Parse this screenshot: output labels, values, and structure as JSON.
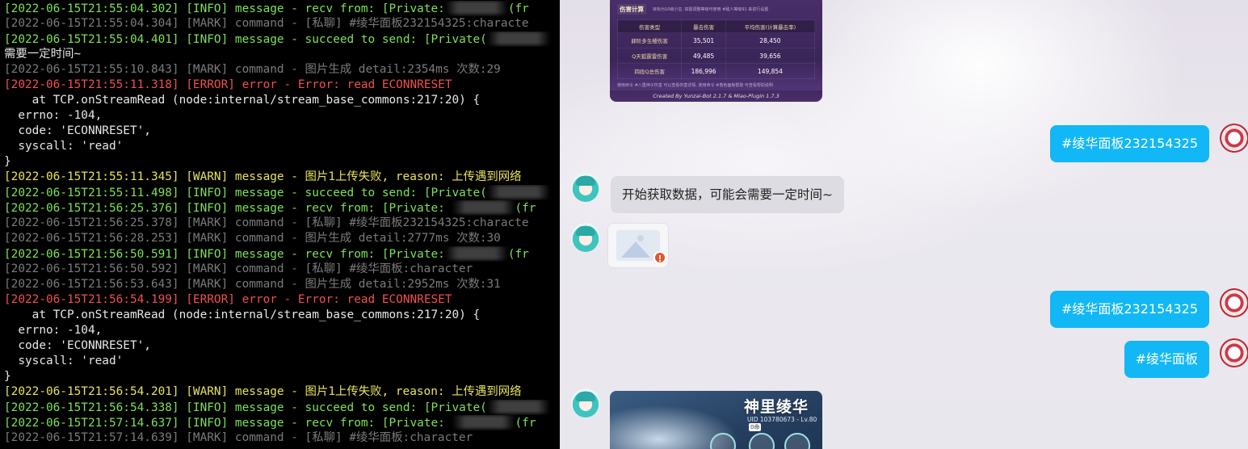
{
  "terminal": {
    "lines": [
      {
        "c": "c-info",
        "t": "[2022-06-15T21:55:04.302] [INFO] message - recv from: [Private:",
        "r": true,
        "s": "(fr"
      },
      {
        "c": "c-mark",
        "t": "[2022-06-15T21:55:04.304] [MARK] command - [私聊] #绫华面板232154325:characte",
        "r": false,
        "s": ""
      },
      {
        "c": "c-info",
        "t": "[2022-06-15T21:55:04.401] [INFO] message - succeed to send: [Private(",
        "r": true,
        "s": ""
      },
      {
        "c": "c-plain",
        "t": "需要一定时间~",
        "r": false,
        "s": ""
      },
      {
        "c": "c-mark",
        "t": "[2022-06-15T21:55:10.843] [MARK] command - 图片生成 detail:2354ms 次数:29",
        "r": false,
        "s": ""
      },
      {
        "c": "c-err",
        "t": "[2022-06-15T21:55:11.318] [ERROR] error - Error: read ECONNRESET",
        "r": false,
        "s": ""
      },
      {
        "c": "c-plain",
        "t": "    at TCP.onStreamRead (node:internal/stream_base_commons:217:20) {",
        "r": false,
        "s": ""
      },
      {
        "c": "c-plain",
        "t": "  errno: -104,",
        "r": false,
        "s": ""
      },
      {
        "c": "c-plain",
        "t": "  code: 'ECONNRESET',",
        "r": false,
        "s": ""
      },
      {
        "c": "c-plain",
        "t": "  syscall: 'read'",
        "r": false,
        "s": ""
      },
      {
        "c": "c-plain",
        "t": "}",
        "r": false,
        "s": ""
      },
      {
        "c": "c-warn",
        "t": "[2022-06-15T21:55:11.345] [WARN] message - 图片1上传失败, reason: 上传遇到网络",
        "r": false,
        "s": ""
      },
      {
        "c": "c-info",
        "t": "[2022-06-15T21:55:11.498] [INFO] message - succeed to send: [Private(",
        "r": true,
        "s": ""
      },
      {
        "c": "c-info",
        "t": "[2022-06-15T21:56:25.376] [INFO] message - recv from: [Private: ",
        "r": true,
        "s": "(fr"
      },
      {
        "c": "c-mark",
        "t": "[2022-06-15T21:56:25.378] [MARK] command - [私聊] #绫华面板232154325:characte",
        "r": false,
        "s": ""
      },
      {
        "c": "c-mark",
        "t": "[2022-06-15T21:56:28.253] [MARK] command - 图片生成 detail:2777ms 次数:30",
        "r": false,
        "s": ""
      },
      {
        "c": "c-info",
        "t": "[2022-06-15T21:56:50.591] [INFO] message - recv from: [Private:",
        "r": true,
        "s": "(fr"
      },
      {
        "c": "c-mark",
        "t": "[2022-06-15T21:56:50.592] [MARK] command - [私聊] #绫华面板:character",
        "r": false,
        "s": ""
      },
      {
        "c": "c-mark",
        "t": "[2022-06-15T21:56:53.643] [MARK] command - 图片生成 detail:2952ms 次数:31",
        "r": false,
        "s": ""
      },
      {
        "c": "c-err",
        "t": "[2022-06-15T21:56:54.199] [ERROR] error - Error: read ECONNRESET",
        "r": false,
        "s": ""
      },
      {
        "c": "c-plain",
        "t": "    at TCP.onStreamRead (node:internal/stream_base_commons:217:20) {",
        "r": false,
        "s": ""
      },
      {
        "c": "c-plain",
        "t": "  errno: -104,",
        "r": false,
        "s": ""
      },
      {
        "c": "c-plain",
        "t": "  code: 'ECONNRESET',",
        "r": false,
        "s": ""
      },
      {
        "c": "c-plain",
        "t": "  syscall: 'read'",
        "r": false,
        "s": ""
      },
      {
        "c": "c-plain",
        "t": "}",
        "r": false,
        "s": ""
      },
      {
        "c": "c-warn",
        "t": "[2022-06-15T21:56:54.201] [WARN] message - 图片1上传失败, reason: 上传遇到网络",
        "r": false,
        "s": ""
      },
      {
        "c": "c-info",
        "t": "[2022-06-15T21:56:54.338] [INFO] message - succeed to send: [Private(",
        "r": true,
        "s": ""
      },
      {
        "c": "c-info",
        "t": "[2022-06-15T21:57:14.637] [INFO] message - recv from: [Private: ",
        "r": true,
        "s": "(fr"
      },
      {
        "c": "c-mark",
        "t": "[2022-06-15T21:57:14.639] [MARK] command - [私聊] #绫华面板:character",
        "r": false,
        "s": ""
      }
    ]
  },
  "chat": {
    "damage_card": {
      "title": "伤害计算",
      "subtitle": "目标为10级小宝, 如需调整等级可使用 #敌人等级91 来进行设置",
      "headers": [
        "伤害类型",
        "暴击伤害",
        "平均伤害(计算暴击率)"
      ],
      "rows": [
        [
          "肆阶多生樱伤害",
          "35,501",
          "28,450"
        ],
        [
          "Q天狐霆雷伤害",
          "49,485",
          "39,656"
        ],
        [
          "四段Q总伤害",
          "186,996",
          "149,854"
        ]
      ],
      "note": "使用命令 #八重神子伤害 可以查看伤害详情, 使用命令 #角色面板帮助 可查看帮助说明",
      "footer": "Created By Yunzai-Bot 2.1.7 & Miao-Plugin 1.7.3"
    },
    "msg_out_1": "#绫华面板232154325",
    "msg_in_1": "开始获取数据，可能会需要一定时间~",
    "failed_image_icon": "image-load-failed-icon",
    "failed_image_mark": "!",
    "msg_out_2": "#绫华面板232154325",
    "msg_out_3": "#绫华面板",
    "character_card": {
      "name": "神里绫华",
      "info": "UID 103780673 - Lv.80",
      "constellation": "0命"
    }
  }
}
